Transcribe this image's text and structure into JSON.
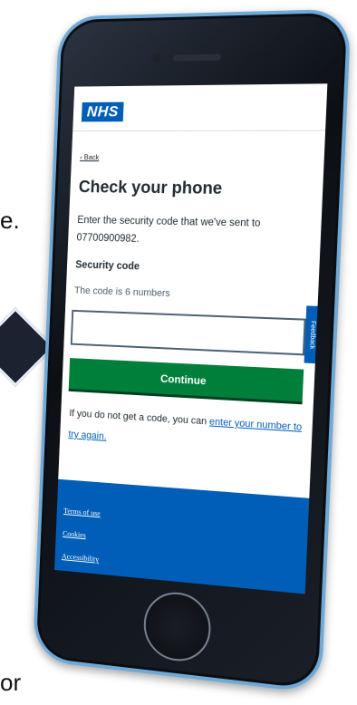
{
  "background": {
    "slide_fragment_top": "e.",
    "slide_fragment_bottom": "or"
  },
  "app": {
    "logo_text": "NHS",
    "back_link": "Back",
    "title": "Check your phone",
    "lede": "Enter the security code that we've sent to 07700900982.",
    "field": {
      "label": "Security code",
      "hint": "The code is 6 numbers",
      "value": ""
    },
    "feedback_tab": "Feedback",
    "continue_label": "Continue",
    "help": {
      "prefix": "If you do not get a code, you can ",
      "link": "enter your number to try again."
    },
    "footer_links": [
      "Terms of use",
      "Cookies",
      "Accessibility"
    ]
  },
  "colors": {
    "nhs_blue": "#005eb8",
    "button_green": "#007f3b",
    "phone_frame_edge": "#6fa9d8"
  }
}
